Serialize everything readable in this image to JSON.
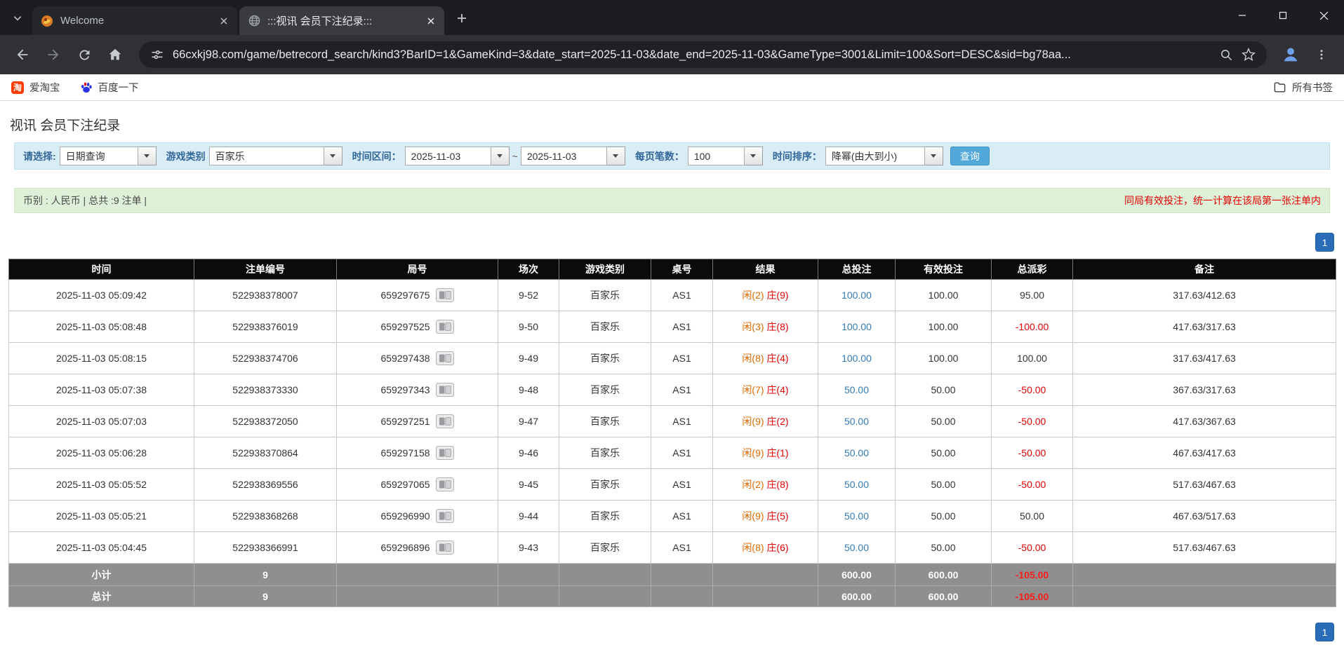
{
  "colors": {
    "header_bg": "#0b0b0b",
    "link_blue": "#337ab7",
    "negative_red": "#e60000",
    "player_orange": "#e06a00",
    "banker_red": "#e60000",
    "pagination_blue": "#2b6cb8",
    "filter_bg": "#d9edf7",
    "info_bg": "#dff0d8",
    "button_blue": "#52a8d9"
  },
  "browser": {
    "tabs": [
      {
        "title": "Welcome"
      },
      {
        "title": ":::视讯 会员下注纪录:::"
      }
    ],
    "url": "66cxkj98.com/game/betrecord_search/kind3?BarID=1&GameKind=3&date_start=2025-11-03&date_end=2025-11-03&GameType=3001&Limit=100&Sort=DESC&sid=bg78aa...",
    "bookmarks": [
      {
        "label": "爱淘宝",
        "icon_text": "淘"
      },
      {
        "label": "百度一下"
      }
    ],
    "all_bookmarks_label": "所有书签"
  },
  "page": {
    "title": "视讯 会员下注纪录",
    "filters": {
      "select_label": "请选择:",
      "select_value": "日期查询",
      "game_type_label": "游戏类别",
      "game_type_value": "百家乐",
      "date_range_label": "时间区间：",
      "date_start": "2025-11-03",
      "date_separator": "~",
      "date_end": "2025-11-03",
      "page_size_label": "每页笔数：",
      "page_size_value": "100",
      "sort_label": "时间排序：",
      "sort_value": "降幂(由大到小)",
      "search_button": "查询"
    },
    "info_bar": {
      "left": "币别 : 人民币 | 总共 :9 注单 |",
      "right": "同局有效投注，统一计算在该局第一张注单内"
    },
    "pagination": {
      "current": "1"
    },
    "table": {
      "headers": [
        "时间",
        "注单编号",
        "局号",
        "场次",
        "游戏类别",
        "桌号",
        "结果",
        "总投注",
        "有效投注",
        "总派彩",
        "备注"
      ],
      "rows": [
        {
          "time": "2025-11-03 05:09:42",
          "bet_id": "522938378007",
          "round_id": "659297675",
          "session": "9-52",
          "game": "百家乐",
          "table_no": "AS1",
          "result_player": "闲(2)",
          "result_banker": "庄(9)",
          "total_bet": "100.00",
          "valid_bet": "100.00",
          "payout": "95.00",
          "remark": "317.63/412.63"
        },
        {
          "time": "2025-11-03 05:08:48",
          "bet_id": "522938376019",
          "round_id": "659297525",
          "session": "9-50",
          "game": "百家乐",
          "table_no": "AS1",
          "result_player": "闲(3)",
          "result_banker": "庄(8)",
          "total_bet": "100.00",
          "valid_bet": "100.00",
          "payout": "-100.00",
          "remark": "417.63/317.63"
        },
        {
          "time": "2025-11-03 05:08:15",
          "bet_id": "522938374706",
          "round_id": "659297438",
          "session": "9-49",
          "game": "百家乐",
          "table_no": "AS1",
          "result_player": "闲(8)",
          "result_banker": "庄(4)",
          "total_bet": "100.00",
          "valid_bet": "100.00",
          "payout": "100.00",
          "remark": "317.63/417.63"
        },
        {
          "time": "2025-11-03 05:07:38",
          "bet_id": "522938373330",
          "round_id": "659297343",
          "session": "9-48",
          "game": "百家乐",
          "table_no": "AS1",
          "result_player": "闲(7)",
          "result_banker": "庄(4)",
          "total_bet": "50.00",
          "valid_bet": "50.00",
          "payout": "-50.00",
          "remark": "367.63/317.63"
        },
        {
          "time": "2025-11-03 05:07:03",
          "bet_id": "522938372050",
          "round_id": "659297251",
          "session": "9-47",
          "game": "百家乐",
          "table_no": "AS1",
          "result_player": "闲(9)",
          "result_banker": "庄(2)",
          "total_bet": "50.00",
          "valid_bet": "50.00",
          "payout": "-50.00",
          "remark": "417.63/367.63"
        },
        {
          "time": "2025-11-03 05:06:28",
          "bet_id": "522938370864",
          "round_id": "659297158",
          "session": "9-46",
          "game": "百家乐",
          "table_no": "AS1",
          "result_player": "闲(9)",
          "result_banker": "庄(1)",
          "total_bet": "50.00",
          "valid_bet": "50.00",
          "payout": "-50.00",
          "remark": "467.63/417.63"
        },
        {
          "time": "2025-11-03 05:05:52",
          "bet_id": "522938369556",
          "round_id": "659297065",
          "session": "9-45",
          "game": "百家乐",
          "table_no": "AS1",
          "result_player": "闲(2)",
          "result_banker": "庄(8)",
          "total_bet": "50.00",
          "valid_bet": "50.00",
          "payout": "-50.00",
          "remark": "517.63/467.63"
        },
        {
          "time": "2025-11-03 05:05:21",
          "bet_id": "522938368268",
          "round_id": "659296990",
          "session": "9-44",
          "game": "百家乐",
          "table_no": "AS1",
          "result_player": "闲(9)",
          "result_banker": "庄(5)",
          "total_bet": "50.00",
          "valid_bet": "50.00",
          "payout": "50.00",
          "remark": "467.63/517.63"
        },
        {
          "time": "2025-11-03 05:04:45",
          "bet_id": "522938366991",
          "round_id": "659296896",
          "session": "9-43",
          "game": "百家乐",
          "table_no": "AS1",
          "result_player": "闲(8)",
          "result_banker": "庄(6)",
          "total_bet": "50.00",
          "valid_bet": "50.00",
          "payout": "-50.00",
          "remark": "517.63/467.63"
        }
      ],
      "subtotal": {
        "label": "小计",
        "count": "9",
        "total_bet": "600.00",
        "valid_bet": "600.00",
        "payout": "-105.00"
      },
      "total": {
        "label": "总计",
        "count": "9",
        "total_bet": "600.00",
        "valid_bet": "600.00",
        "payout": "-105.00"
      }
    }
  }
}
